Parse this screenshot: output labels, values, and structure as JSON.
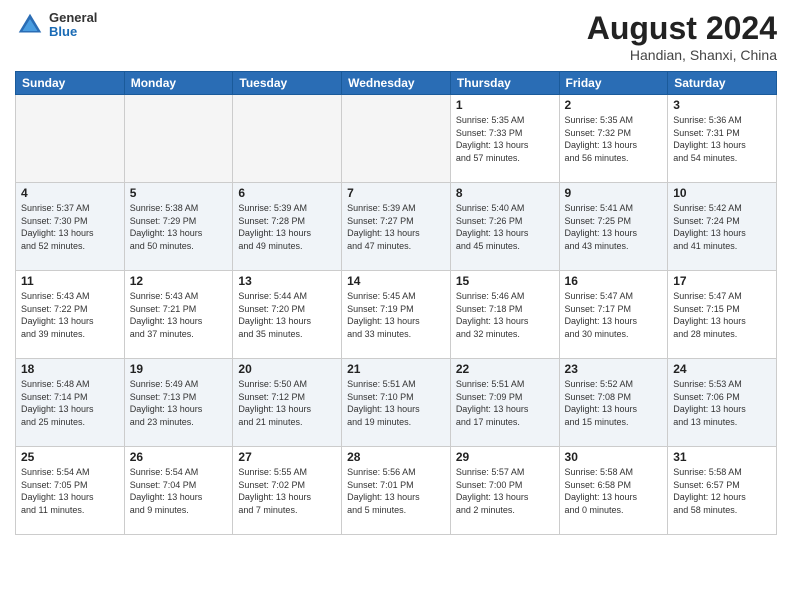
{
  "header": {
    "logo_general": "General",
    "logo_blue": "Blue",
    "month_year": "August 2024",
    "location": "Handian, Shanxi, China"
  },
  "days_of_week": [
    "Sunday",
    "Monday",
    "Tuesday",
    "Wednesday",
    "Thursday",
    "Friday",
    "Saturday"
  ],
  "weeks": [
    [
      {
        "day": "",
        "info": ""
      },
      {
        "day": "",
        "info": ""
      },
      {
        "day": "",
        "info": ""
      },
      {
        "day": "",
        "info": ""
      },
      {
        "day": "1",
        "info": "Sunrise: 5:35 AM\nSunset: 7:33 PM\nDaylight: 13 hours\nand 57 minutes."
      },
      {
        "day": "2",
        "info": "Sunrise: 5:35 AM\nSunset: 7:32 PM\nDaylight: 13 hours\nand 56 minutes."
      },
      {
        "day": "3",
        "info": "Sunrise: 5:36 AM\nSunset: 7:31 PM\nDaylight: 13 hours\nand 54 minutes."
      }
    ],
    [
      {
        "day": "4",
        "info": "Sunrise: 5:37 AM\nSunset: 7:30 PM\nDaylight: 13 hours\nand 52 minutes."
      },
      {
        "day": "5",
        "info": "Sunrise: 5:38 AM\nSunset: 7:29 PM\nDaylight: 13 hours\nand 50 minutes."
      },
      {
        "day": "6",
        "info": "Sunrise: 5:39 AM\nSunset: 7:28 PM\nDaylight: 13 hours\nand 49 minutes."
      },
      {
        "day": "7",
        "info": "Sunrise: 5:39 AM\nSunset: 7:27 PM\nDaylight: 13 hours\nand 47 minutes."
      },
      {
        "day": "8",
        "info": "Sunrise: 5:40 AM\nSunset: 7:26 PM\nDaylight: 13 hours\nand 45 minutes."
      },
      {
        "day": "9",
        "info": "Sunrise: 5:41 AM\nSunset: 7:25 PM\nDaylight: 13 hours\nand 43 minutes."
      },
      {
        "day": "10",
        "info": "Sunrise: 5:42 AM\nSunset: 7:24 PM\nDaylight: 13 hours\nand 41 minutes."
      }
    ],
    [
      {
        "day": "11",
        "info": "Sunrise: 5:43 AM\nSunset: 7:22 PM\nDaylight: 13 hours\nand 39 minutes."
      },
      {
        "day": "12",
        "info": "Sunrise: 5:43 AM\nSunset: 7:21 PM\nDaylight: 13 hours\nand 37 minutes."
      },
      {
        "day": "13",
        "info": "Sunrise: 5:44 AM\nSunset: 7:20 PM\nDaylight: 13 hours\nand 35 minutes."
      },
      {
        "day": "14",
        "info": "Sunrise: 5:45 AM\nSunset: 7:19 PM\nDaylight: 13 hours\nand 33 minutes."
      },
      {
        "day": "15",
        "info": "Sunrise: 5:46 AM\nSunset: 7:18 PM\nDaylight: 13 hours\nand 32 minutes."
      },
      {
        "day": "16",
        "info": "Sunrise: 5:47 AM\nSunset: 7:17 PM\nDaylight: 13 hours\nand 30 minutes."
      },
      {
        "day": "17",
        "info": "Sunrise: 5:47 AM\nSunset: 7:15 PM\nDaylight: 13 hours\nand 28 minutes."
      }
    ],
    [
      {
        "day": "18",
        "info": "Sunrise: 5:48 AM\nSunset: 7:14 PM\nDaylight: 13 hours\nand 25 minutes."
      },
      {
        "day": "19",
        "info": "Sunrise: 5:49 AM\nSunset: 7:13 PM\nDaylight: 13 hours\nand 23 minutes."
      },
      {
        "day": "20",
        "info": "Sunrise: 5:50 AM\nSunset: 7:12 PM\nDaylight: 13 hours\nand 21 minutes."
      },
      {
        "day": "21",
        "info": "Sunrise: 5:51 AM\nSunset: 7:10 PM\nDaylight: 13 hours\nand 19 minutes."
      },
      {
        "day": "22",
        "info": "Sunrise: 5:51 AM\nSunset: 7:09 PM\nDaylight: 13 hours\nand 17 minutes."
      },
      {
        "day": "23",
        "info": "Sunrise: 5:52 AM\nSunset: 7:08 PM\nDaylight: 13 hours\nand 15 minutes."
      },
      {
        "day": "24",
        "info": "Sunrise: 5:53 AM\nSunset: 7:06 PM\nDaylight: 13 hours\nand 13 minutes."
      }
    ],
    [
      {
        "day": "25",
        "info": "Sunrise: 5:54 AM\nSunset: 7:05 PM\nDaylight: 13 hours\nand 11 minutes."
      },
      {
        "day": "26",
        "info": "Sunrise: 5:54 AM\nSunset: 7:04 PM\nDaylight: 13 hours\nand 9 minutes."
      },
      {
        "day": "27",
        "info": "Sunrise: 5:55 AM\nSunset: 7:02 PM\nDaylight: 13 hours\nand 7 minutes."
      },
      {
        "day": "28",
        "info": "Sunrise: 5:56 AM\nSunset: 7:01 PM\nDaylight: 13 hours\nand 5 minutes."
      },
      {
        "day": "29",
        "info": "Sunrise: 5:57 AM\nSunset: 7:00 PM\nDaylight: 13 hours\nand 2 minutes."
      },
      {
        "day": "30",
        "info": "Sunrise: 5:58 AM\nSunset: 6:58 PM\nDaylight: 13 hours\nand 0 minutes."
      },
      {
        "day": "31",
        "info": "Sunrise: 5:58 AM\nSunset: 6:57 PM\nDaylight: 12 hours\nand 58 minutes."
      }
    ]
  ]
}
